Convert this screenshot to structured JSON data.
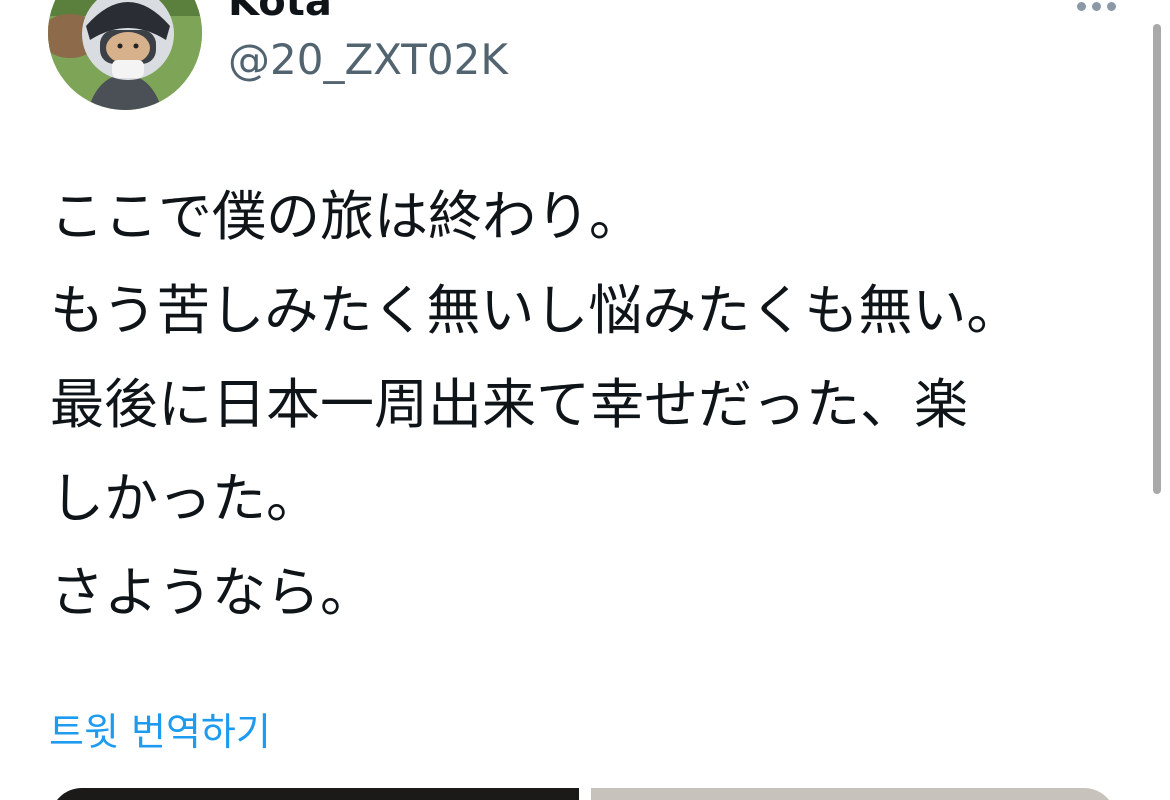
{
  "header": {
    "display_name": "Kota",
    "handle": "@20_ZXT02K",
    "avatar_icon": "profile-photo-rider-with-helmet",
    "more_icon": "more-horizontal-icon"
  },
  "tweet": {
    "lines": [
      "ここで僕の旅は終わり。",
      "もう苦しみたく無いし悩みたくも無い。",
      "最後に日本一周出来て幸せだった、楽",
      "しかった。",
      "さようなら。"
    ],
    "translate_label": "트윗 번역하기"
  },
  "colors": {
    "text": "#0f1419",
    "secondary_text": "#536471",
    "link": "#1d9bf0",
    "background": "#ffffff"
  }
}
